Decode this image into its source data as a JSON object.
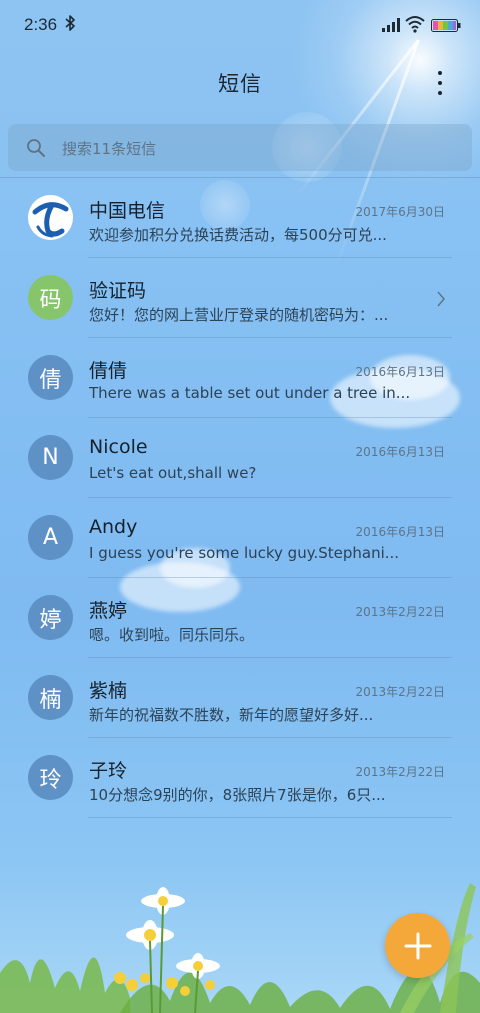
{
  "status_bar": {
    "time": "2:36",
    "bluetooth_icon": "bluetooth-icon",
    "signal_icon": "signal-icon",
    "wifi_icon": "wifi-icon",
    "battery_icon": "battery-icon"
  },
  "header": {
    "title": "短信",
    "more_icon": "more-vertical-icon"
  },
  "search": {
    "placeholder": "搜索11条短信"
  },
  "conversations": [
    {
      "name": "中国电信",
      "avatar_text": "",
      "avatar_icon": "china-telecom-logo",
      "date": "2017年6月30日",
      "preview": "欢迎参加积分兑换话费活动，每500分可兑..."
    },
    {
      "name": "验证码",
      "avatar_text": "码",
      "date": "",
      "preview": "您好！您的网上营业厅登录的随机密码为：...",
      "trailing_icon": "chevron-right-icon"
    },
    {
      "name": "倩倩",
      "avatar_text": "倩",
      "date": "2016年6月13日",
      "preview": "There was a table set out under a tree in..."
    },
    {
      "name": "Nicole",
      "avatar_text": "N",
      "date": "2016年6月13日",
      "preview": "Let's eat out,shall we?"
    },
    {
      "name": "Andy",
      "avatar_text": "A",
      "date": "2016年6月13日",
      "preview": "I guess you're some lucky guy.Stephani..."
    },
    {
      "name": "燕婷",
      "avatar_text": "婷",
      "date": "2013年2月22日",
      "preview": "嗯。收到啦。同乐同乐。"
    },
    {
      "name": "紫楠",
      "avatar_text": "楠",
      "date": "2013年2月22日",
      "preview": "新年的祝福数不胜数，新年的愿望好多好..."
    },
    {
      "name": "子玲",
      "avatar_text": "玲",
      "date": "2013年2月22日",
      "preview": "10分想念9别的你，8张照片7张是你，6只..."
    }
  ],
  "fab": {
    "icon": "plus-icon",
    "color": "#f4a83a"
  },
  "colors": {
    "background": "#86c0f3",
    "avatar_default": "#5e92c6",
    "avatar_green": "#86c56b",
    "fab": "#f4a83a"
  }
}
